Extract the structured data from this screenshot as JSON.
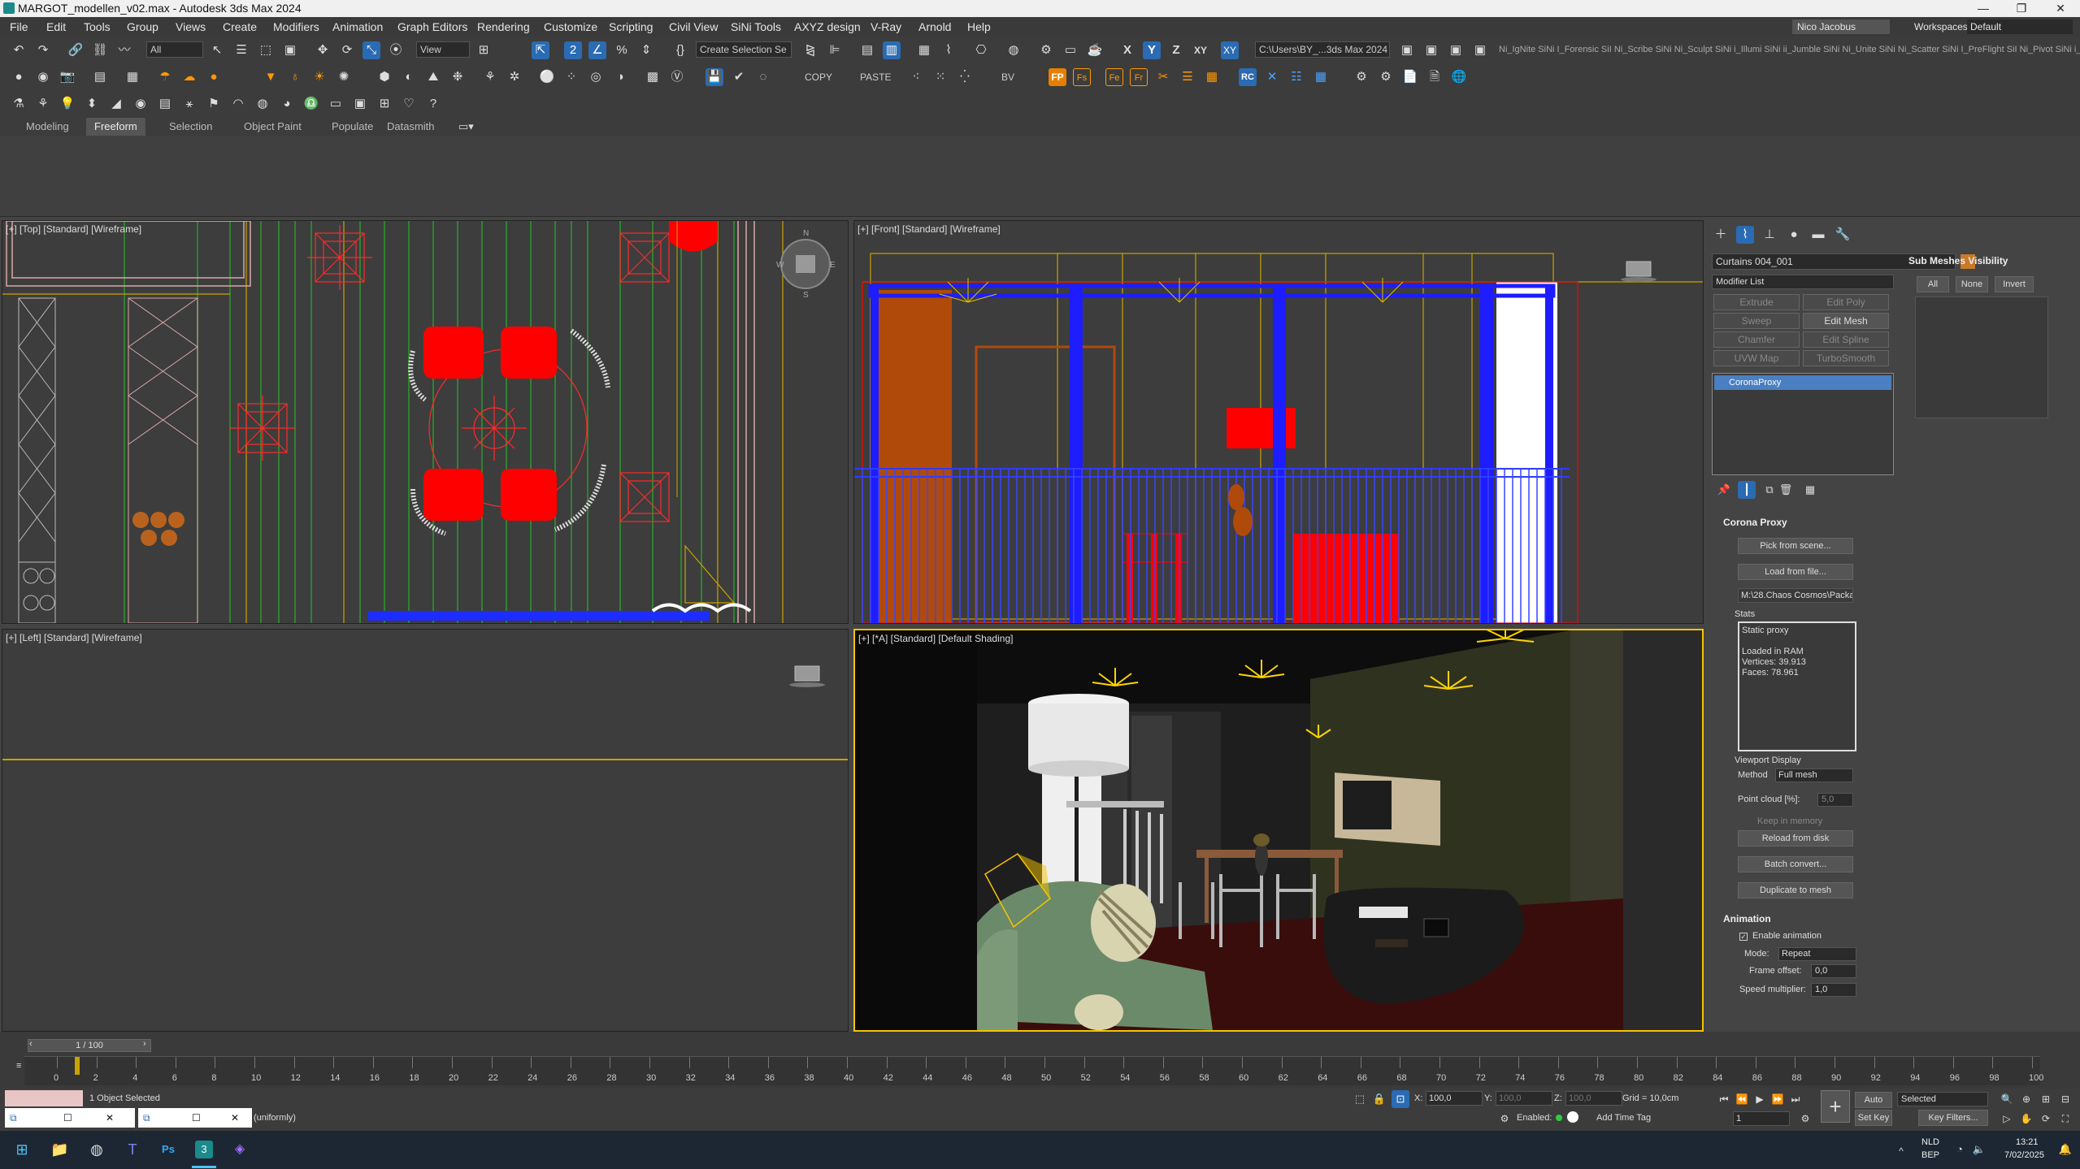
{
  "titlebar": {
    "title": "MARGOT_modellen_v02.max - Autodesk 3ds Max 2024"
  },
  "menu": [
    "File",
    "Edit",
    "Tools",
    "Group",
    "Views",
    "Create",
    "Modifiers",
    "Animation",
    "Graph Editors",
    "Rendering",
    "Customize",
    "Scripting",
    "Civil View",
    "SiNi Tools",
    "AXYZ design",
    "V-Ray",
    "Arnold",
    "Help"
  ],
  "account": {
    "user": "Nico Jacobus",
    "workspaces_label": "Workspaces:",
    "workspace": "Default"
  },
  "toolbar": {
    "selection_filter": "All",
    "ref_coord": "View",
    "named_selection": "Create Selection Se",
    "project_path": "C:\\Users\\BY_...3ds Max 2024",
    "sini_strip": "Ni_IgNite  SiNi I_Forensic  SiI Ni_Scribe  SiNi Ni_Sculpt  SiNi i_Illumi  SiNi  ii_Jumble  SiNi Ni_Unite  SiNi Ni_Scatter  SiNi I_PreFlight  SiI Ni_Pivot  SiNi i_Ila",
    "copy": "COPY",
    "paste": "PASTE",
    "bv": "BV",
    "rc": "RC",
    "fp": "FP"
  },
  "ribbon_tabs": [
    "Modeling",
    "Freeform",
    "Selection",
    "Object Paint",
    "Populate",
    "Datasmith"
  ],
  "viewports": {
    "top": "[+] [Top] [Standard] [Wireframe]",
    "front": "[+] [Front] [Standard] [Wireframe]",
    "left": "[+] [Left] [Standard] [Wireframe]",
    "persp": "[+] [*A] [Standard] [Default Shading]"
  },
  "command_panel": {
    "object_name": "Curtains 004_001",
    "modifier_list": "Modifier List",
    "mod_buttons": [
      {
        "label": "Extrude",
        "enabled": false
      },
      {
        "label": "Edit Poly",
        "enabled": false
      },
      {
        "label": "Sweep",
        "enabled": false
      },
      {
        "label": "Edit Mesh",
        "enabled": true
      },
      {
        "label": "Chamfer",
        "enabled": false
      },
      {
        "label": "Edit Spline",
        "enabled": false
      },
      {
        "label": "UVW Map",
        "enabled": false
      },
      {
        "label": "TurboSmooth",
        "enabled": false
      }
    ],
    "stack_item": "CoronaProxy",
    "sub_meshes_title": "Sub Meshes Visibility",
    "sub_meshes_buttons": [
      "All",
      "None",
      "Invert"
    ],
    "corona_proxy_title": "Corona Proxy",
    "pick_from_scene": "Pick from scene...",
    "load_from_file": "Load from file...",
    "file_path": "M:\\28.Chaos Cosmos\\Packag",
    "stats_label": "Stats",
    "stats_lines": [
      "Static proxy",
      "",
      "Loaded in RAM",
      "Vertices: 39.913",
      "Faces: 78.961"
    ],
    "viewport_display_label": "Viewport Display",
    "method_label": "Method",
    "method_value": "Full mesh",
    "point_cloud_label": "Point cloud [%]:",
    "point_cloud_value": "5,0",
    "keep_in_memory": "Keep in memory",
    "reload_from_disk": "Reload from disk",
    "batch_convert": "Batch convert...",
    "duplicate_to_mesh": "Duplicate to mesh",
    "animation_title": "Animation",
    "enable_animation": "Enable animation",
    "mode_label": "Mode:",
    "mode_value": "Repeat",
    "frame_offset_label": "Frame offset:",
    "frame_offset_value": "0,0",
    "speed_multiplier_label": "Speed multiplier:",
    "speed_multiplier_value": "1,0"
  },
  "timeline": {
    "frame_counter": "1 / 100",
    "ticks": [
      "0",
      "2",
      "4",
      "6",
      "8",
      "10",
      "12",
      "14",
      "16",
      "18",
      "20",
      "22",
      "24",
      "26",
      "28",
      "30",
      "32",
      "34",
      "36",
      "38",
      "40",
      "42",
      "44",
      "46",
      "48",
      "50",
      "52",
      "54",
      "56",
      "58",
      "60",
      "62",
      "64",
      "66",
      "68",
      "70",
      "72",
      "74",
      "76",
      "78",
      "80",
      "82",
      "84",
      "86",
      "88",
      "90",
      "92",
      "94",
      "96",
      "98",
      "100"
    ]
  },
  "status": {
    "selection": "1 Object Selected",
    "prompt": "(uniformly)",
    "x_label": "X:",
    "x_value": "100,0",
    "y_label": "Y:",
    "y_value": "100,0",
    "z_label": "Z:",
    "z_value": "100,0",
    "grid": "Grid = 10,0cm",
    "enabled_label": "Enabled:",
    "add_time_tag": "Add Time Tag",
    "auto_key": "Auto Key",
    "set_key": "Set Key",
    "key_mode": "Selected",
    "key_filters": "Key Filters...",
    "frame_value": "1"
  },
  "taskbar": {
    "lang": "NLD",
    "region": "BEP",
    "time": "13:21",
    "date": "7/02/2025"
  },
  "colors": {
    "accent_blue": "#2a6bb3",
    "viewport_active": "#f5c400",
    "wire_red": "#ff0000",
    "wire_blue": "#0000ff"
  }
}
